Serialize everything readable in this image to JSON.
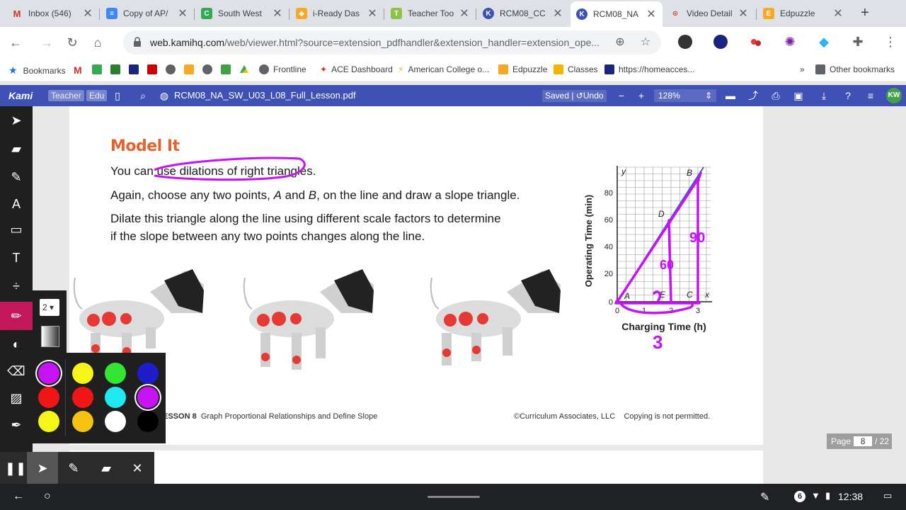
{
  "tabs": [
    {
      "title": "Inbox (546)",
      "icon": "gmail-icon",
      "color": "#d93025"
    },
    {
      "title": "Copy of AP/",
      "icon": "docs-icon",
      "color": "#4285f4"
    },
    {
      "title": "South West",
      "icon": "classroom-icon",
      "color": "#34a853"
    },
    {
      "title": "i-Ready Das",
      "icon": "iready-icon",
      "color": "#f9a825"
    },
    {
      "title": "Teacher Too",
      "icon": "teacher-tool-icon",
      "color": "#e53935"
    },
    {
      "title": "RCM08_CC",
      "icon": "kami-icon",
      "color": "#3f51b5"
    },
    {
      "title": "RCM08_NA",
      "icon": "kami-icon",
      "color": "#3f51b5"
    },
    {
      "title": "Video Detail",
      "icon": "video-icon",
      "color": "#e53935"
    },
    {
      "title": "Edpuzzle",
      "icon": "edpuzzle-icon",
      "color": "#f9a825"
    }
  ],
  "address": {
    "host": "web.kamihq.com",
    "path": "/web/viewer.html?source=extension_pdfhandler&extension_handler=extension_ope..."
  },
  "bookmarks": [
    {
      "label": "Bookmarks",
      "icon": "star-icon"
    },
    {
      "label": "Frontline",
      "icon": "globe-icon"
    },
    {
      "label": "ACE Dashboard",
      "icon": "ace-icon"
    },
    {
      "label": "American College o...",
      "icon": "acl-icon"
    },
    {
      "label": "Edpuzzle",
      "icon": "edpuzzle-icon"
    },
    {
      "label": "Classes",
      "icon": "classes-icon"
    },
    {
      "label": "https://homeacces...",
      "icon": "hac-icon"
    },
    {
      "label": "Other bookmarks",
      "icon": "folder-icon"
    }
  ],
  "kami": {
    "logo": "Kami",
    "badge_teacher": "Teacher",
    "badge_edu": "Edu",
    "filename": "RCM08_NA_SW_U03_L08_Full_Lesson.pdf",
    "saved": "Saved",
    "undo": "Undo",
    "zoom": "128%",
    "avatar": "KW"
  },
  "doc": {
    "heading": "Model It",
    "line1": "You can use dilations of right triangles.",
    "line2_a": "Again, choose any two points, ",
    "line2_A": "A",
    "line2_and": " and ",
    "line2_B": "B",
    "line2_b": ", on the line and draw a slope triangle.",
    "line3": "Dilate this triangle along the line using different scale factors to determine",
    "line4": "if the slope between any two points changes along the line.",
    "footer_lesson": "ESSON 8",
    "footer_title": "Graph Proportional Relationships and Define Slope",
    "footer_copy": "©Curriculum Associates, LLC",
    "footer_notice": "Copying is not permitted."
  },
  "graph": {
    "ylabel": "Operating Time (min)",
    "xlabel": "Charging Time (h)",
    "yticks": [
      "80",
      "60",
      "40",
      "20",
      "0"
    ],
    "xticks": [
      "0",
      "1",
      "2",
      "3"
    ],
    "axis_y": "y",
    "axis_x": "x",
    "pt_A": "A",
    "pt_B": "B",
    "pt_C": "C",
    "pt_D": "D",
    "pt_E": "E",
    "ink_60": "60",
    "ink_90": "90",
    "ink_3": "3"
  },
  "size_value": "2",
  "page_indicator": {
    "label": "Page",
    "current": "8",
    "total": "/ 22"
  },
  "swatches": [
    "#c513f5",
    "#f5f51a",
    "#33e633",
    "#1d1dc9",
    "#f01616",
    "#f01616",
    "#1ee8f0",
    "#c513f5",
    "#f5f51a",
    "#f5c211",
    "#ffffff",
    "#000000"
  ],
  "shelf": {
    "time": "12:38",
    "notifications": "6"
  }
}
